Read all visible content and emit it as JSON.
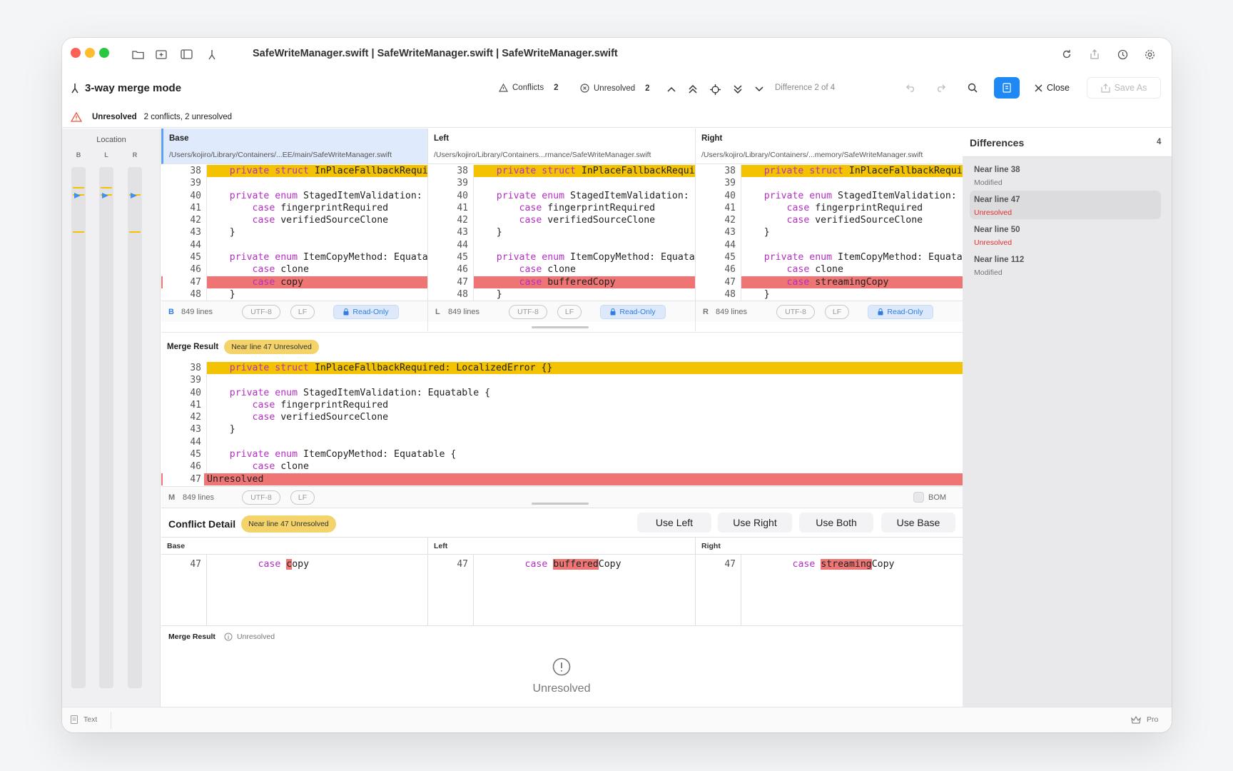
{
  "window": {
    "title": "SafeWriteManager.swift | SafeWriteManager.swift | SafeWriteManager.swift"
  },
  "toolbar": {
    "mode_label": "3-way merge mode",
    "conflicts_label": "Conflicts",
    "conflicts_count": "2",
    "unresolved_label": "Unresolved",
    "unresolved_count": "2",
    "difference_text": "Difference 2 of 4",
    "close_label": "Close",
    "save_as_label": "Save As"
  },
  "status": {
    "label": "Unresolved",
    "detail": "2 conflicts, 2 unresolved"
  },
  "location": {
    "title": "Location",
    "lanes": [
      "B",
      "L",
      "R"
    ]
  },
  "panes": [
    {
      "name": "Base",
      "path": "/Users/kojiro/Library/Containers/...EE/main/SafeWriteManager.swift",
      "footer_letter": "B",
      "lines_count": "849 lines",
      "encoding": "UTF-8",
      "eol": "LF",
      "readonly": "Read-Only",
      "line47": "copy"
    },
    {
      "name": "Left",
      "path": "/Users/kojiro/Library/Containers...rmance/SafeWriteManager.swift",
      "footer_letter": "L",
      "lines_count": "849 lines",
      "encoding": "UTF-8",
      "eol": "LF",
      "readonly": "Read-Only",
      "line47": "bufferedCopy"
    },
    {
      "name": "Right",
      "path": "/Users/kojiro/Library/Containers/...memory/SafeWriteManager.swift",
      "footer_letter": "R",
      "lines_count": "849 lines",
      "encoding": "UTF-8",
      "eol": "LF",
      "readonly": "Read-Only",
      "line47": "streamingCopy"
    }
  ],
  "code": {
    "lines": [
      {
        "n": "38",
        "kw1": "private",
        "kw2": "struct",
        "rest": " InPlaceFallbackRequired: LocalizedError {}"
      },
      {
        "n": "39",
        "kw1": "",
        "kw2": "",
        "rest": ""
      },
      {
        "n": "40",
        "kw1": "private",
        "kw2": "enum",
        "rest": " StagedItemValidation: Equatable {"
      },
      {
        "n": "41",
        "kw1": "",
        "kw2": "case",
        "rest": " fingerprintRequired"
      },
      {
        "n": "42",
        "kw1": "",
        "kw2": "case",
        "rest": " verifiedSourceClone"
      },
      {
        "n": "43",
        "kw1": "",
        "kw2": "",
        "rest": "}"
      },
      {
        "n": "44",
        "kw1": "",
        "kw2": "",
        "rest": ""
      },
      {
        "n": "45",
        "kw1": "private",
        "kw2": "enum",
        "rest": " ItemCopyMethod: Equatable {"
      },
      {
        "n": "46",
        "kw1": "",
        "kw2": "case",
        "rest": " clone"
      },
      {
        "n": "47",
        "kw1": "",
        "kw2": "case",
        "rest": ""
      },
      {
        "n": "48",
        "kw1": "",
        "kw2": "",
        "rest": "}"
      }
    ]
  },
  "merge": {
    "title": "Merge Result",
    "badge": "Near line 47  Unresolved",
    "line47_text": "Unresolved",
    "footer_letter": "M",
    "lines_count": "849 lines",
    "encoding": "UTF-8",
    "eol": "LF",
    "bom": "BOM"
  },
  "conflict": {
    "title": "Conflict Detail",
    "badge": "Near line 47  Unresolved",
    "buttons": [
      "Use Left",
      "Use Right",
      "Use Both",
      "Use Base"
    ],
    "columns": [
      "Base",
      "Left",
      "Right"
    ],
    "line_num": "47",
    "case_kw": "case",
    "base_mark": "c",
    "base_rest": "opy",
    "left_mark": "buffered",
    "left_rest": "Copy",
    "right_mark": "streaming",
    "right_rest": "Copy",
    "merge_label": "Merge Result",
    "merge_status": "Unresolved",
    "unresolved_big": "Unresolved"
  },
  "sidebar": {
    "title": "Differences",
    "count": "4",
    "items": [
      {
        "title": "Near line 38",
        "status": "Modified"
      },
      {
        "title": "Near line 47",
        "status": "Unresolved"
      },
      {
        "title": "Near line 50",
        "status": "Unresolved"
      },
      {
        "title": "Near line 112",
        "status": "Modified"
      }
    ]
  },
  "bottom": {
    "text_label": "Text",
    "pro_label": "Pro"
  },
  "colors": {
    "conflict_yellow": "#f3c200",
    "conflict_red": "#ef7474",
    "keyword": "#b42fc3",
    "accent_blue": "#2f7de1",
    "unresolved_red": "#e0302a"
  }
}
